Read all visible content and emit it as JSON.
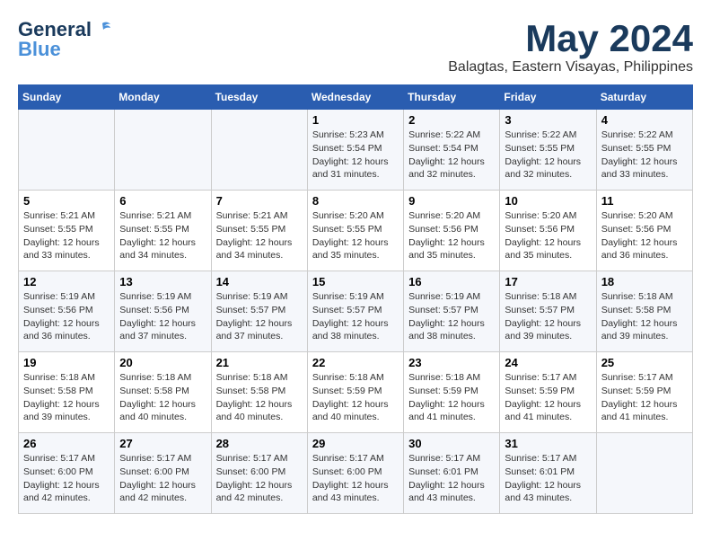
{
  "header": {
    "logo_general": "General",
    "logo_blue": "Blue",
    "month": "May 2024",
    "location": "Balagtas, Eastern Visayas, Philippines"
  },
  "days_of_week": [
    "Sunday",
    "Monday",
    "Tuesday",
    "Wednesday",
    "Thursday",
    "Friday",
    "Saturday"
  ],
  "weeks": [
    {
      "cells": [
        {
          "day": "",
          "info": ""
        },
        {
          "day": "",
          "info": ""
        },
        {
          "day": "",
          "info": ""
        },
        {
          "day": "1",
          "info": "Sunrise: 5:23 AM\nSunset: 5:54 PM\nDaylight: 12 hours\nand 31 minutes."
        },
        {
          "day": "2",
          "info": "Sunrise: 5:22 AM\nSunset: 5:54 PM\nDaylight: 12 hours\nand 32 minutes."
        },
        {
          "day": "3",
          "info": "Sunrise: 5:22 AM\nSunset: 5:55 PM\nDaylight: 12 hours\nand 32 minutes."
        },
        {
          "day": "4",
          "info": "Sunrise: 5:22 AM\nSunset: 5:55 PM\nDaylight: 12 hours\nand 33 minutes."
        }
      ]
    },
    {
      "cells": [
        {
          "day": "5",
          "info": "Sunrise: 5:21 AM\nSunset: 5:55 PM\nDaylight: 12 hours\nand 33 minutes."
        },
        {
          "day": "6",
          "info": "Sunrise: 5:21 AM\nSunset: 5:55 PM\nDaylight: 12 hours\nand 34 minutes."
        },
        {
          "day": "7",
          "info": "Sunrise: 5:21 AM\nSunset: 5:55 PM\nDaylight: 12 hours\nand 34 minutes."
        },
        {
          "day": "8",
          "info": "Sunrise: 5:20 AM\nSunset: 5:55 PM\nDaylight: 12 hours\nand 35 minutes."
        },
        {
          "day": "9",
          "info": "Sunrise: 5:20 AM\nSunset: 5:56 PM\nDaylight: 12 hours\nand 35 minutes."
        },
        {
          "day": "10",
          "info": "Sunrise: 5:20 AM\nSunset: 5:56 PM\nDaylight: 12 hours\nand 35 minutes."
        },
        {
          "day": "11",
          "info": "Sunrise: 5:20 AM\nSunset: 5:56 PM\nDaylight: 12 hours\nand 36 minutes."
        }
      ]
    },
    {
      "cells": [
        {
          "day": "12",
          "info": "Sunrise: 5:19 AM\nSunset: 5:56 PM\nDaylight: 12 hours\nand 36 minutes."
        },
        {
          "day": "13",
          "info": "Sunrise: 5:19 AM\nSunset: 5:56 PM\nDaylight: 12 hours\nand 37 minutes."
        },
        {
          "day": "14",
          "info": "Sunrise: 5:19 AM\nSunset: 5:57 PM\nDaylight: 12 hours\nand 37 minutes."
        },
        {
          "day": "15",
          "info": "Sunrise: 5:19 AM\nSunset: 5:57 PM\nDaylight: 12 hours\nand 38 minutes."
        },
        {
          "day": "16",
          "info": "Sunrise: 5:19 AM\nSunset: 5:57 PM\nDaylight: 12 hours\nand 38 minutes."
        },
        {
          "day": "17",
          "info": "Sunrise: 5:18 AM\nSunset: 5:57 PM\nDaylight: 12 hours\nand 39 minutes."
        },
        {
          "day": "18",
          "info": "Sunrise: 5:18 AM\nSunset: 5:58 PM\nDaylight: 12 hours\nand 39 minutes."
        }
      ]
    },
    {
      "cells": [
        {
          "day": "19",
          "info": "Sunrise: 5:18 AM\nSunset: 5:58 PM\nDaylight: 12 hours\nand 39 minutes."
        },
        {
          "day": "20",
          "info": "Sunrise: 5:18 AM\nSunset: 5:58 PM\nDaylight: 12 hours\nand 40 minutes."
        },
        {
          "day": "21",
          "info": "Sunrise: 5:18 AM\nSunset: 5:58 PM\nDaylight: 12 hours\nand 40 minutes."
        },
        {
          "day": "22",
          "info": "Sunrise: 5:18 AM\nSunset: 5:59 PM\nDaylight: 12 hours\nand 40 minutes."
        },
        {
          "day": "23",
          "info": "Sunrise: 5:18 AM\nSunset: 5:59 PM\nDaylight: 12 hours\nand 41 minutes."
        },
        {
          "day": "24",
          "info": "Sunrise: 5:17 AM\nSunset: 5:59 PM\nDaylight: 12 hours\nand 41 minutes."
        },
        {
          "day": "25",
          "info": "Sunrise: 5:17 AM\nSunset: 5:59 PM\nDaylight: 12 hours\nand 41 minutes."
        }
      ]
    },
    {
      "cells": [
        {
          "day": "26",
          "info": "Sunrise: 5:17 AM\nSunset: 6:00 PM\nDaylight: 12 hours\nand 42 minutes."
        },
        {
          "day": "27",
          "info": "Sunrise: 5:17 AM\nSunset: 6:00 PM\nDaylight: 12 hours\nand 42 minutes."
        },
        {
          "day": "28",
          "info": "Sunrise: 5:17 AM\nSunset: 6:00 PM\nDaylight: 12 hours\nand 42 minutes."
        },
        {
          "day": "29",
          "info": "Sunrise: 5:17 AM\nSunset: 6:00 PM\nDaylight: 12 hours\nand 43 minutes."
        },
        {
          "day": "30",
          "info": "Sunrise: 5:17 AM\nSunset: 6:01 PM\nDaylight: 12 hours\nand 43 minutes."
        },
        {
          "day": "31",
          "info": "Sunrise: 5:17 AM\nSunset: 6:01 PM\nDaylight: 12 hours\nand 43 minutes."
        },
        {
          "day": "",
          "info": ""
        }
      ]
    }
  ]
}
